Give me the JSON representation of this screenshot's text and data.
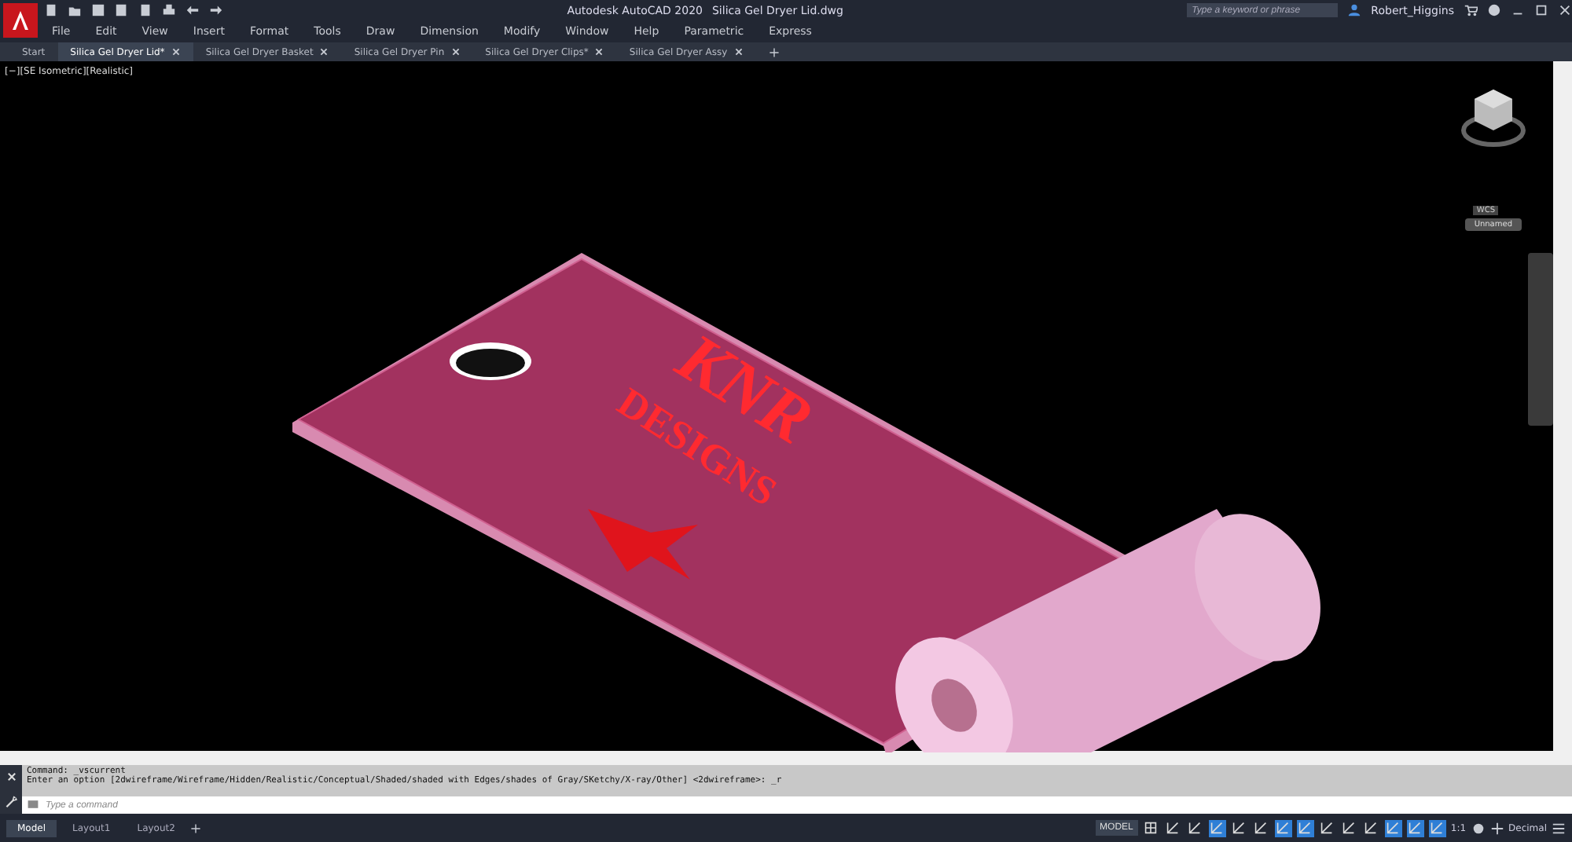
{
  "app_title": "Autodesk AutoCAD 2020",
  "file_title": "Silica Gel Dryer Lid.dwg",
  "quick_access": [
    {
      "kind": "new"
    },
    {
      "kind": "open"
    },
    {
      "kind": "save"
    },
    {
      "kind": "saveas"
    },
    {
      "kind": "plot"
    },
    {
      "kind": "print"
    },
    {
      "kind": "undo"
    },
    {
      "kind": "redo"
    }
  ],
  "menu": [
    "File",
    "Edit",
    "View",
    "Insert",
    "Format",
    "Tools",
    "Draw",
    "Dimension",
    "Modify",
    "Window",
    "Help",
    "Parametric",
    "Express"
  ],
  "search": {
    "placeholder": "Type a keyword or phrase"
  },
  "user": "Robert_Higgins",
  "tabs": [
    {
      "label": "Start",
      "selected": false,
      "closable": false
    },
    {
      "label": "Silica Gel Dryer Lid*",
      "selected": true,
      "closable": true
    },
    {
      "label": "Silica Gel Dryer Basket",
      "selected": false,
      "closable": true
    },
    {
      "label": "Silica Gel Dryer Pin",
      "selected": false,
      "closable": true
    },
    {
      "label": "Silica Gel Dryer Clips*",
      "selected": false,
      "closable": true
    },
    {
      "label": "Silica Gel Dryer Assy",
      "selected": false,
      "closable": true
    }
  ],
  "viewport": {
    "label": "[−][SE Isometric][Realistic]",
    "model_text": [
      "KNR",
      "DESIGNS"
    ],
    "wcs": "WCS",
    "ucs": "Unnamed"
  },
  "command": {
    "history": [
      "Command: _vscurrent",
      "Enter an option [2dwireframe/Wireframe/Hidden/Realistic/Conceptual/Shaded/shaded with Edges/shades of Gray/SKetchy/X-ray/Other] <2dwireframe>: _r"
    ],
    "placeholder": "Type a command"
  },
  "layout_tabs": [
    {
      "label": "Model",
      "selected": true
    },
    {
      "label": "Layout1",
      "selected": false
    },
    {
      "label": "Layout2",
      "selected": false
    }
  ],
  "status": {
    "model": "MODEL",
    "scale": "1:1",
    "units": "Decimal",
    "toggles": [
      {
        "kind": "grid",
        "on": false
      },
      {
        "kind": "snap",
        "on": false
      },
      {
        "kind": "ortho",
        "on": false
      },
      {
        "kind": "infer",
        "on": true
      },
      {
        "kind": "polar",
        "on": false
      },
      {
        "kind": "iso",
        "on": false
      },
      {
        "kind": "track",
        "on": true
      },
      {
        "kind": "osnap",
        "on": true
      },
      {
        "kind": "lineweight",
        "on": false
      },
      {
        "kind": "transparency",
        "on": false
      },
      {
        "kind": "selcycle",
        "on": false
      },
      {
        "kind": "gizmo",
        "on": true
      },
      {
        "kind": "annomon",
        "on": true
      },
      {
        "kind": "isolate",
        "on": true
      }
    ]
  }
}
